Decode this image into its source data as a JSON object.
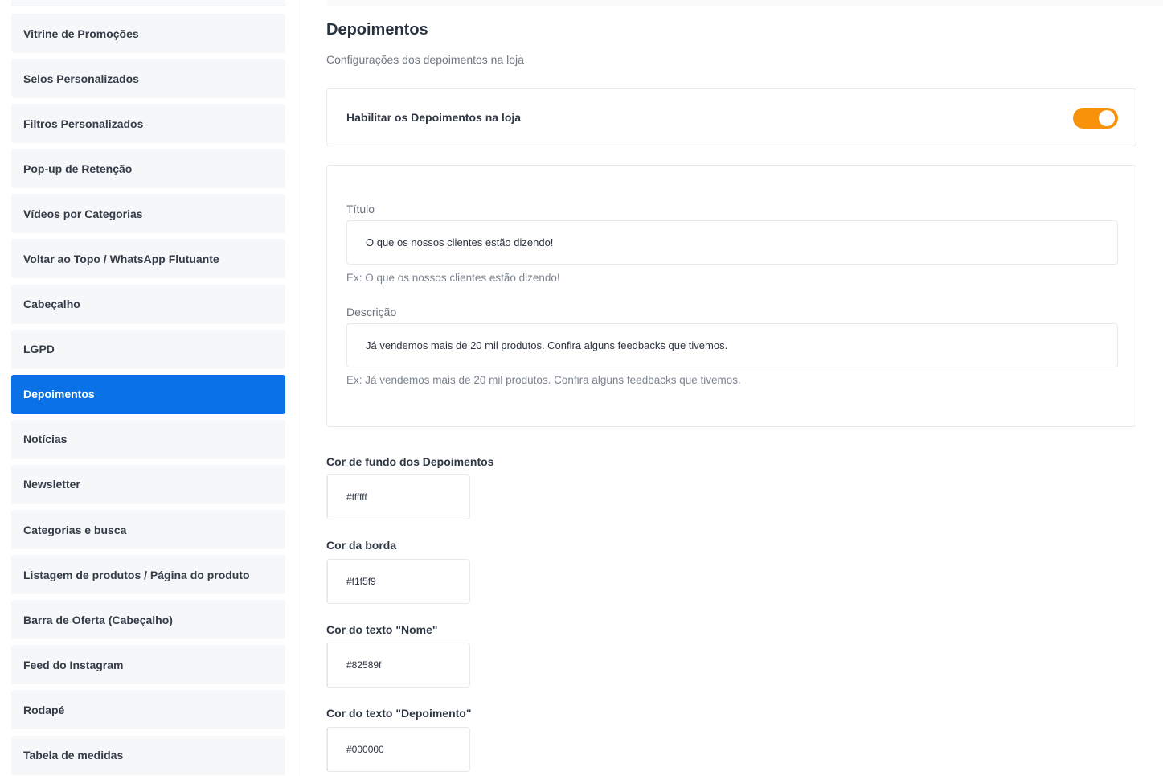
{
  "sidebar": {
    "items": [
      {
        "label": "Vitrine de Promoções",
        "active": false
      },
      {
        "label": "Selos Personalizados",
        "active": false
      },
      {
        "label": "Filtros Personalizados",
        "active": false
      },
      {
        "label": "Pop-up de Retenção",
        "active": false
      },
      {
        "label": "Vídeos por Categorias",
        "active": false
      },
      {
        "label": "Voltar ao Topo / WhatsApp Flutuante",
        "active": false
      },
      {
        "label": "Cabeçalho",
        "active": false
      },
      {
        "label": "LGPD",
        "active": false
      },
      {
        "label": "Depoimentos",
        "active": true
      },
      {
        "label": "Notícias",
        "active": false
      },
      {
        "label": "Newsletter",
        "active": false
      },
      {
        "label": "Categorias e busca",
        "active": false
      },
      {
        "label": "Listagem de produtos / Página do produto",
        "active": false
      },
      {
        "label": "Barra de Oferta (Cabeçalho)",
        "active": false
      },
      {
        "label": "Feed do Instagram",
        "active": false
      },
      {
        "label": "Rodapé",
        "active": false
      },
      {
        "label": "Tabela de medidas",
        "active": false
      }
    ],
    "active_color": "#0a72e6"
  },
  "main": {
    "title": "Depoimentos",
    "subtitle": "Configurações dos depoimentos na loja",
    "enable": {
      "label": "Habilitar os Depoimentos na loja",
      "enabled": true,
      "color": "#f8920b"
    },
    "form": {
      "title_label": "Título",
      "title_value": "O que os nossos clientes estão dizendo!",
      "title_hint": "Ex: O que os nossos clientes estão dizendo!",
      "description_label": "Descrição",
      "description_value": "Já vendemos mais de 20 mil produtos. Confira alguns feedbacks que tivemos.",
      "description_hint": "Ex: Já vendemos mais de 20 mil produtos. Confira alguns feedbacks que tivemos."
    },
    "colors": [
      {
        "label": "Cor de fundo dos Depoimentos",
        "value": "#ffffff"
      },
      {
        "label": "Cor da borda",
        "value": "#f1f5f9"
      },
      {
        "label": "Cor do texto \"Nome\"",
        "value": "#82589f"
      },
      {
        "label": "Cor do texto \"Depoimento\"",
        "value": "#000000"
      }
    ]
  }
}
